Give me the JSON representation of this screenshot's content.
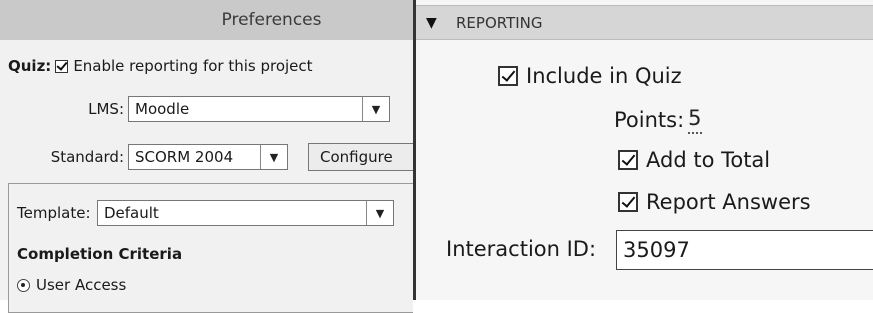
{
  "prefs": {
    "title": "Preferences",
    "quiz_label": "Quiz:",
    "enable_reporting": "Enable reporting for this project",
    "lms_label": "LMS:",
    "lms_value": "Moodle",
    "standard_label": "Standard:",
    "standard_value": "SCORM 2004",
    "configure_label": "Configure",
    "template_label": "Template:",
    "template_value": "Default",
    "completion_heading": "Completion Criteria",
    "user_access_label": "User Access"
  },
  "reporting": {
    "header": "REPORTING",
    "include_in_quiz": "Include in Quiz",
    "points_label": "Points:",
    "points_value": "5",
    "add_to_total": "Add to Total",
    "report_answers": "Report Answers",
    "interaction_id_label": "Interaction ID:",
    "interaction_id_value": "35097"
  }
}
